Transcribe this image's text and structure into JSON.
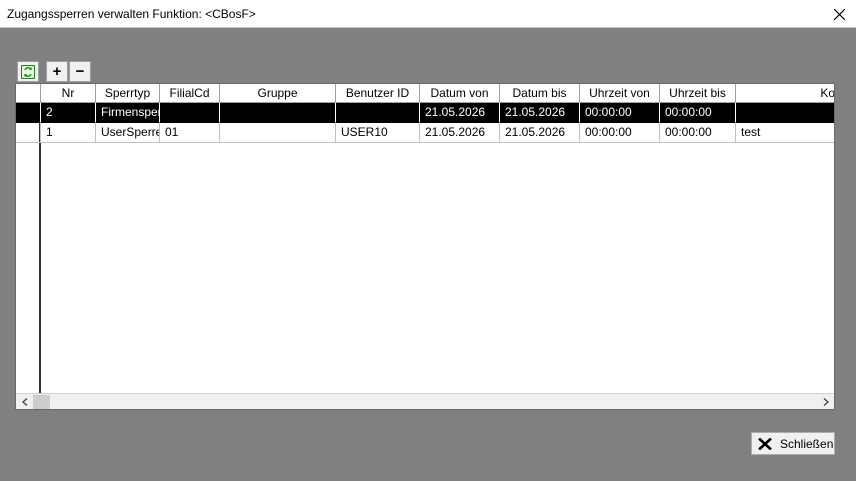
{
  "window": {
    "title": "Zugangssperren verwalten Funktion: <CBosF>"
  },
  "toolbar": {
    "refresh_icon": "refresh-icon",
    "add_label": "+",
    "remove_label": "−"
  },
  "table": {
    "columns": [
      "Nr",
      "Sperrtyp",
      "FilialCd",
      "Gruppe",
      "Benutzer ID",
      "Datum von",
      "Datum bis",
      "Uhrzeit von",
      "Uhrzeit bis",
      "Ko"
    ],
    "rows": [
      {
        "nr": "2",
        "sperrtyp": "Firmensperr",
        "filialcd": "",
        "gruppe": "",
        "benutzer_id": "",
        "datum_von": "21.05.2026",
        "datum_bis": "21.05.2026",
        "uhrzeit_von": "00:00:00",
        "uhrzeit_bis": "00:00:00",
        "kommentar": ""
      },
      {
        "nr": "1",
        "sperrtyp": "UserSperre",
        "filialcd": "01",
        "gruppe": "",
        "benutzer_id": "USER10",
        "datum_von": "21.05.2026",
        "datum_bis": "21.05.2026",
        "uhrzeit_von": "00:00:00",
        "uhrzeit_bis": "00:00:00",
        "kommentar": "test"
      }
    ],
    "selected_row": 0
  },
  "footer": {
    "close_label": "Schließen"
  },
  "colors": {
    "background": "#808080",
    "selected_row": "#000000",
    "refresh_icon": "#1a8a1a"
  }
}
